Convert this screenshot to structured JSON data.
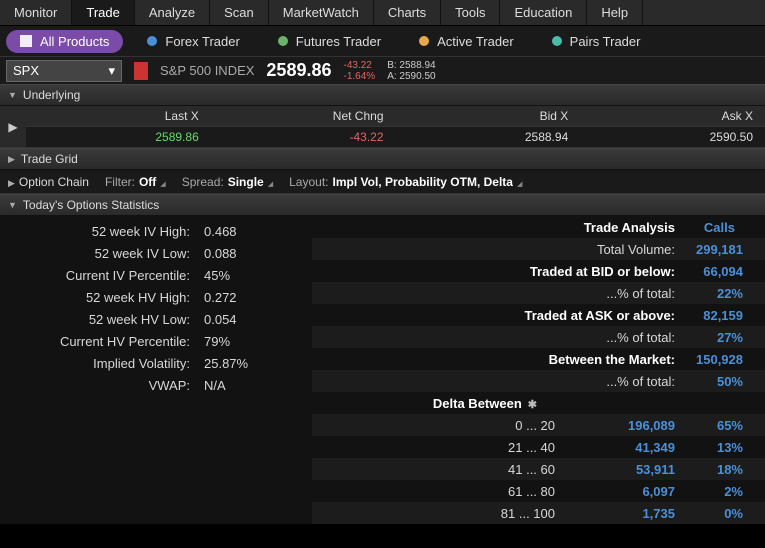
{
  "main_tabs": [
    "Monitor",
    "Trade",
    "Analyze",
    "Scan",
    "MarketWatch",
    "Charts",
    "Tools",
    "Education",
    "Help"
  ],
  "active_main_tab": "Trade",
  "sub_tabs": [
    {
      "label": "All Products",
      "active": true
    },
    {
      "label": "Forex Trader"
    },
    {
      "label": "Futures Trader"
    },
    {
      "label": "Active Trader"
    },
    {
      "label": "Pairs Trader"
    }
  ],
  "symbol": {
    "ticker": "SPX",
    "name": "S&P 500 INDEX",
    "price": "2589.86",
    "change": "-43.22",
    "pct": "-1.64%",
    "bid": "B: 2588.94",
    "ask": "A: 2590.50"
  },
  "sections": {
    "underlying": "Underlying",
    "trade_grid": "Trade Grid",
    "option_chain": "Option Chain",
    "todays_stats": "Today's Options Statistics"
  },
  "underlying": {
    "headers": [
      "Last X",
      "Net Chng",
      "Bid X",
      "Ask X"
    ],
    "values": [
      "2589.86",
      "-43.22",
      "2588.94",
      "2590.50"
    ]
  },
  "option_chain_bar": {
    "filter_label": "Filter:",
    "filter_value": "Off",
    "spread_label": "Spread:",
    "spread_value": "Single",
    "layout_label": "Layout:",
    "layout_value": "Impl Vol, Probability OTM, Delta"
  },
  "stats_left": [
    {
      "label": "52 week IV High:",
      "value": "0.468"
    },
    {
      "label": "52 week IV Low:",
      "value": "0.088"
    },
    {
      "label": "Current IV Percentile:",
      "value": "45%"
    },
    {
      "label": "52 week HV High:",
      "value": "0.272"
    },
    {
      "label": "52 week HV Low:",
      "value": "0.054"
    },
    {
      "label": "Current HV Percentile:",
      "value": "79%"
    },
    {
      "label": "Implied Volatility:",
      "value": "25.87%"
    },
    {
      "label": "VWAP:",
      "value": "N/A"
    }
  ],
  "trade_analysis": {
    "header": {
      "label": "Trade Analysis",
      "calls": "Calls"
    },
    "rows": [
      {
        "label": "Total Volume:",
        "value": "299,181",
        "bold": false
      },
      {
        "label": "Traded at BID or below:",
        "value": "66,094",
        "bold": true
      },
      {
        "label": "...% of total:",
        "value": "22%",
        "bold": false
      },
      {
        "label": "Traded at ASK or above:",
        "value": "82,159",
        "bold": true
      },
      {
        "label": "...% of total:",
        "value": "27%",
        "bold": false
      },
      {
        "label": "Between the Market:",
        "value": "150,928",
        "bold": true
      },
      {
        "label": "...% of total:",
        "value": "50%",
        "bold": false
      }
    ],
    "delta_header": "Delta Between",
    "delta_rows": [
      {
        "range": "0 ... 20",
        "value": "196,089",
        "pct": "65%"
      },
      {
        "range": "21 ... 40",
        "value": "41,349",
        "pct": "13%"
      },
      {
        "range": "41 ... 60",
        "value": "53,911",
        "pct": "18%"
      },
      {
        "range": "61 ... 80",
        "value": "6,097",
        "pct": "2%"
      },
      {
        "range": "81 ... 100",
        "value": "1,735",
        "pct": "0%"
      }
    ]
  }
}
